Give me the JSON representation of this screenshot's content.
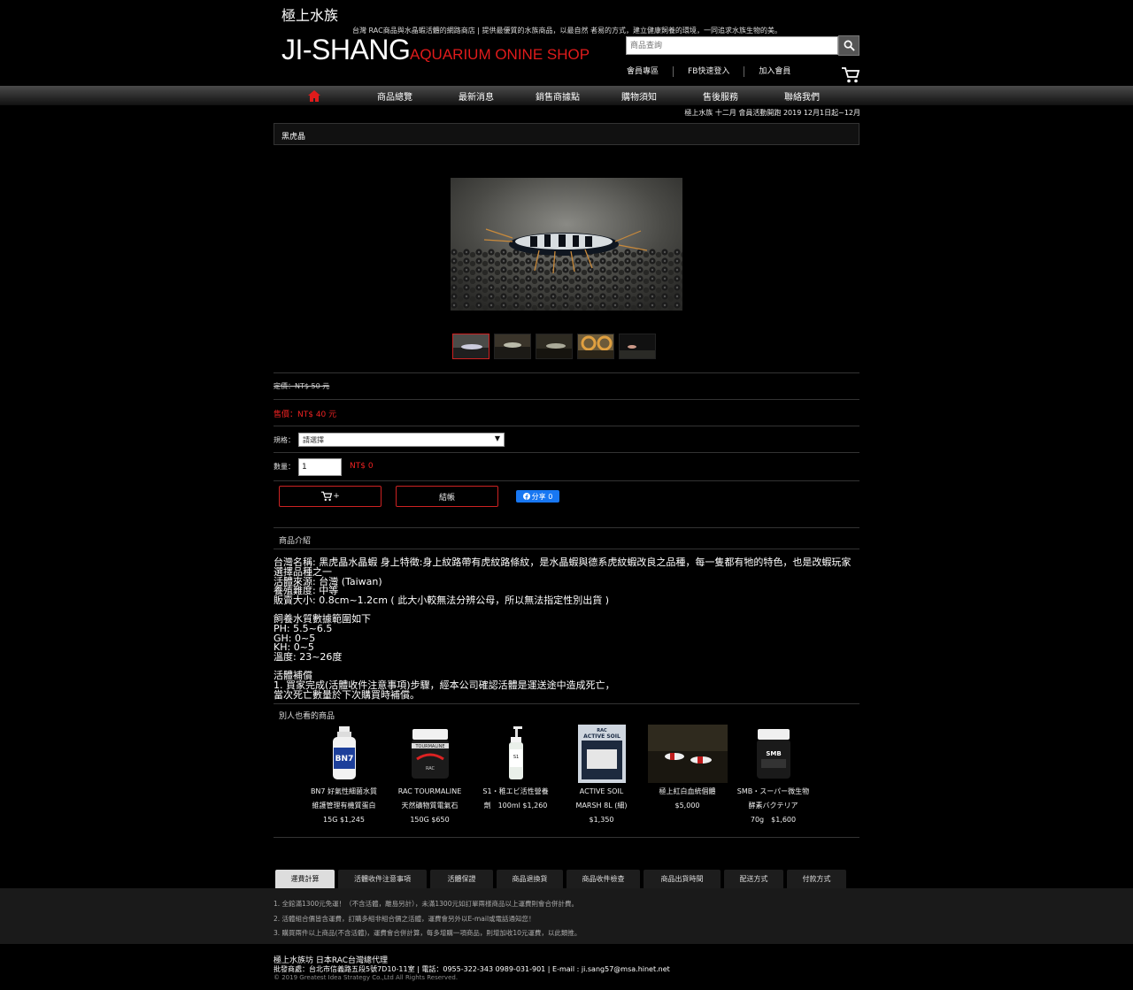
{
  "header": {
    "logo_cn": "極上水族",
    "tagline": "台灣 RAC商品與水晶蝦活體的網路商店 | 提供最優質的水族商品，以最自然 者易的方式，建立健康飼養的環境，一同追求水族生物的美。",
    "logo_en": "JI-SHANG",
    "logo_sub": "AQUARIUM  ONINE SHOP",
    "search_placeholder": "商品查詢",
    "links": [
      "會員專區",
      "FB快速登入",
      "加入會員"
    ]
  },
  "nav": {
    "items": [
      "商品總覽",
      "最新消息",
      "銷售商據點",
      "購物須知",
      "售後服務",
      "聯絡我們"
    ]
  },
  "marquee": "極上水族 十二月 會員活動開跑 2019 12月1日起~12月",
  "breadcrumb": "黑虎晶",
  "product": {
    "original_price": "定價：NT$ 50 元",
    "sale_price": "售價：NT$ 40 元",
    "spec_label": "規格：",
    "spec_value": "請選擇",
    "qty_label": "數量：",
    "qty_value": "1",
    "total": "NT$ 0",
    "add_cart_label": "+",
    "checkout_label": "結帳",
    "fb_share": "分享 0"
  },
  "sections": {
    "intro_title": "商品介紹",
    "related_title": "別人也看的商品"
  },
  "description": [
    [
      "台灣名稱: 黑虎晶水晶蝦  身上特徵:身上紋路帶有虎紋路條紋，是水晶蝦與德系虎紋蝦改良之品種，每一隻都有牠的特色，也是改蝦玩家選擇品種之一",
      "活體來源: 台灣 (Taiwan)",
      "養殖難度: 中等",
      "販賣大小: 0.8cm~1.2cm ( 此大小較無法分辨公母，所以無法指定性別出貨 )"
    ],
    [
      "飼養水質數據範圍如下",
      "PH: 5.5~6.5",
      "GH: 0~5",
      "KH: 0~5",
      "溫度: 23~26度"
    ],
    [
      "活體補償",
      "1. 買家完成(活體收件注意事項)步驟，經本公司確認活體是運送途中造成死亡，",
      "當次死亡數量於下次購買時補償。"
    ]
  ],
  "related": [
    {
      "lines": [
        "BN7 好氣性細菌水質",
        "維護管理有機質蛋白",
        "15G $1,245"
      ],
      "icon": "bn7-bottle-icon"
    },
    {
      "lines": [
        "RAC TOURMALINE",
        "天然礦物質電氣石",
        "150G $650"
      ],
      "icon": "tourmaline-jar-icon"
    },
    {
      "lines": [
        "S1・稚エビ活性營養",
        "劑　100ml $1,260"
      ],
      "icon": "s1-dropper-bottle-icon"
    },
    {
      "lines": [
        "ACTIVE SOIL",
        "MARSH 8L (細)",
        "$1,350"
      ],
      "icon": "active-soil-bag-icon"
    },
    {
      "lines": [
        "極上紅白血統個體",
        "$5,000"
      ],
      "icon": "red-white-shrimp-photo"
    },
    {
      "lines": [
        "SMB・スーパー微生物",
        "酵素バクテリア",
        "70g　$1,600"
      ],
      "icon": "smb-jar-icon"
    }
  ],
  "tabs": [
    {
      "label": "運費計算",
      "active": true
    },
    {
      "label": "活體收件注意事項"
    },
    {
      "label": "活體保證"
    },
    {
      "label": "商品退換貨"
    },
    {
      "label": "商品收件檢查"
    },
    {
      "label": "商品出貨時間"
    },
    {
      "label": "配送方式"
    },
    {
      "label": "付款方式"
    }
  ],
  "notes": [
    "1. 全館滿1300元免運！（不含活體，離島另計），未滿1300元如訂單兩樣商品以上運費則會合併計費。",
    "2. 活體組合價皆含運費，訂購多組非組合價之活體，運費會另外以E-mail或電話通知您！",
    "3. 購買兩件以上商品(不含活體)，運費會合併計算，每多增購一項商品，則增加收10元運費，以此類推。"
  ],
  "footer": {
    "line1": "極上水族坊 日本RAC台灣總代理",
    "line2": "批發商處：台北市信義路五段5號7D10-11室 | 電話：0955-322-343 0989-031-901 | E-mail : ji.sang57@msa.hinet.net",
    "line3": "© 2019 Greatest Idea Strategy Co.,Ltd All Rights Reserved."
  },
  "colors": {
    "accent": "#e01b1b",
    "fb": "#1877f2"
  }
}
